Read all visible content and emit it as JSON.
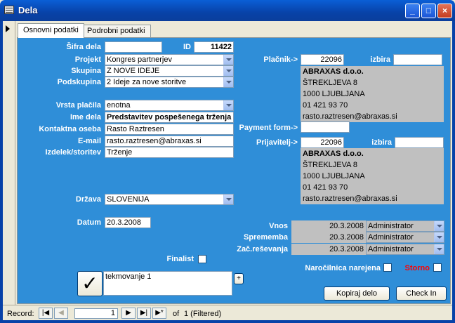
{
  "window": {
    "title": "Dela",
    "minimize": "_",
    "maximize": "□",
    "close": "×"
  },
  "tabs": [
    {
      "label": "Osnovni podatki"
    },
    {
      "label": "Podrobni podatki"
    }
  ],
  "form": {
    "sifra_label": "Šifra dela",
    "sifra_value": "",
    "id_label": "ID",
    "id_value": "11422",
    "projekt_label": "Projekt",
    "projekt_value": "Kongres partnerjev",
    "skupina_label": "Skupina",
    "skupina_value": "Z NOVE IDEJE",
    "podskupina_label": "Podskupina",
    "podskupina_value": "2 Ideje za nove storitve",
    "vrsta_label": "Vrsta plačila",
    "vrsta_value": "enotna",
    "ime_label": "Ime dela",
    "ime_value": "Predstavitev pospešenega trženja",
    "kontakt_label": "Kontaktna oseba",
    "kontakt_value": "Rasto Raztresen",
    "email_label": "E-mail",
    "email_value": "rasto.raztresen@abraxas.si",
    "izdelek_label": "Izdelek/storitev",
    "izdelek_value": "Trženje",
    "drzava_label": "Država",
    "drzava_value": "SLOVENIJA",
    "datum_label": "Datum",
    "datum_value": "20.3.2008",
    "finalist_label": "Finalist",
    "memo_value": "tekmovanje 1",
    "memo_plus": "+",
    "check_glyph": "✓"
  },
  "placnik": {
    "label": "Plačnik->",
    "code": "22096",
    "izbira_label": "izbira",
    "izbira_value": "",
    "lines": [
      "ABRAXAS d.o.o.",
      "ŠTREKLJEVA 8",
      "1000 LJUBLJANA",
      "01 421 93 70",
      "rasto.raztresen@abraxas.si"
    ]
  },
  "payment_form": {
    "label": "Payment form->",
    "value": ""
  },
  "prijavitelj": {
    "label": "Prijavitelj->",
    "code": "22096",
    "izbira_label": "izbira",
    "izbira_value": "",
    "lines": [
      "ABRAXAS d.o.o.",
      "ŠTREKLJEVA 8",
      "1000 LJUBLJANA",
      "01 421 93 70",
      "rasto.raztresen@abraxas.si"
    ]
  },
  "audit": [
    {
      "label": "Vnos",
      "date": "20.3.2008",
      "user": "Administrator"
    },
    {
      "label": "Sprememba",
      "date": "20.3.2008",
      "user": "Administrator"
    },
    {
      "label": "Zač.reševanja",
      "date": "20.3.2008",
      "user": "Administrator"
    }
  ],
  "narocilnica_label": "Naročilnica narejena",
  "storno_label": "Storno",
  "colors": {
    "panel": "#2f8ed8",
    "storno": "#ff0000"
  },
  "buttons": {
    "kopiraj": "Kopiraj delo",
    "checkin": "Check In"
  },
  "nav": {
    "record_label": "Record:",
    "current": "1",
    "of_label": "of",
    "total": "1 (Filtered)",
    "first": "|◀",
    "prev": "◀",
    "next": "▶",
    "last": "▶|",
    "new": "▶*"
  }
}
